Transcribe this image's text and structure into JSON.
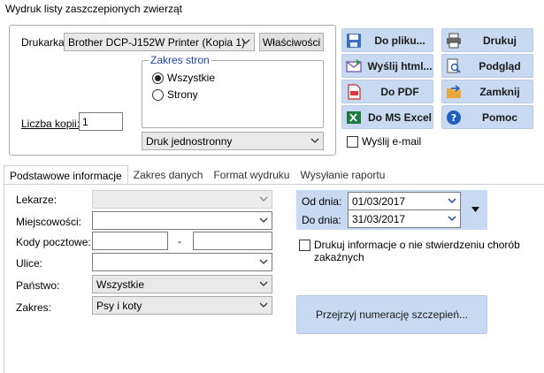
{
  "window": {
    "title": "Wydruk listy zaszczepionych zwierząt"
  },
  "printer": {
    "label": "Drukarka:",
    "value": "Brother DCP-J152W Printer (Kopia 1)",
    "properties_button": "Właściwości",
    "copies_label": "Liczba kopii:",
    "copies_value": "1"
  },
  "page_range": {
    "title": "Zakres stron",
    "option_all": "Wszystkie",
    "option_pages": "Strony",
    "selected": "Wszystkie"
  },
  "duplex": {
    "value": "Druk jednostronny"
  },
  "actions": {
    "to_file": "Do pliku...",
    "send_html": "Wyślij html...",
    "to_pdf": "Do PDF",
    "to_excel": "Do MS Excel",
    "print": "Drukuj",
    "preview": "Podgląd",
    "close": "Zamknij",
    "help": "Pomoc"
  },
  "send_email": {
    "label": "Wyślij e-mail",
    "checked": false
  },
  "tabs": [
    {
      "label": "Podstawowe informacje",
      "active": true
    },
    {
      "label": "Zakres danych",
      "active": false
    },
    {
      "label": "Format wydruku",
      "active": false
    },
    {
      "label": "Wysyłanie raportu",
      "active": false
    }
  ],
  "form": {
    "vets_label": "Lekarze:",
    "vets_value": "",
    "towns_label": "Miejscowości:",
    "towns_value": "",
    "postal_label": "Kody pocztowe:",
    "postal_from": "",
    "postal_separator": "-",
    "postal_to": "",
    "streets_label": "Ulice:",
    "streets_value": "",
    "country_label": "Państwo:",
    "country_value": "Wszystkie",
    "scope_label": "Zakres:",
    "scope_value": "Psy i koty"
  },
  "dates": {
    "from_label": "Od dnia:",
    "from_value": "01/03/2017",
    "to_label": "Do dnia:",
    "to_value": "31/03/2017"
  },
  "diseases": {
    "label": "Drukuj informacje o nie stwierdzeniu chorób zakaźnych",
    "checked": false
  },
  "browse_button": "Przejrzyj numerację szczepień..."
}
